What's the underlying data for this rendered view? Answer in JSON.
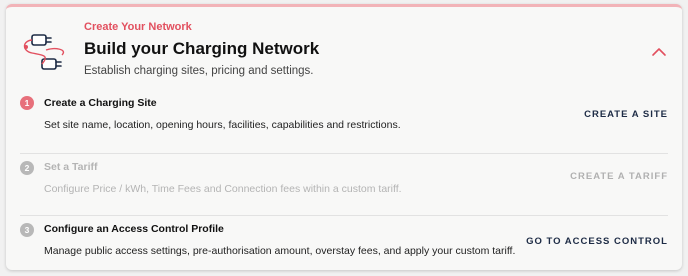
{
  "header": {
    "eyebrow": "Create Your Network",
    "title": "Build your Charging Network",
    "subtitle": "Establish charging sites, pricing and settings.",
    "illustration_icon": "ev-charging-cables-icon",
    "collapse_icon": "chevron-up-icon"
  },
  "steps": [
    {
      "number": "1",
      "title": "Create a Charging Site",
      "description": "Set site name, location, opening hours, facilities, capabilities and restrictions.",
      "action": "CREATE A SITE",
      "enabled": true
    },
    {
      "number": "2",
      "title": "Set a Tariff",
      "description": "Configure Price / kWh, Time Fees and Connection fees within a custom tariff.",
      "action": "CREATE A TARIFF",
      "enabled": false
    },
    {
      "number": "3",
      "title": "Configure an Access Control Profile",
      "description": "Manage public access settings, pre-authorisation amount, overstay fees, and apply your custom tariff.",
      "action": "GO TO ACCESS CONTROL",
      "enabled": true
    }
  ],
  "colors": {
    "accent": "#e2505f",
    "action_text": "#1d2b45",
    "disabled_text": "#b4b4b4",
    "top_border": "#f2b3b8"
  }
}
